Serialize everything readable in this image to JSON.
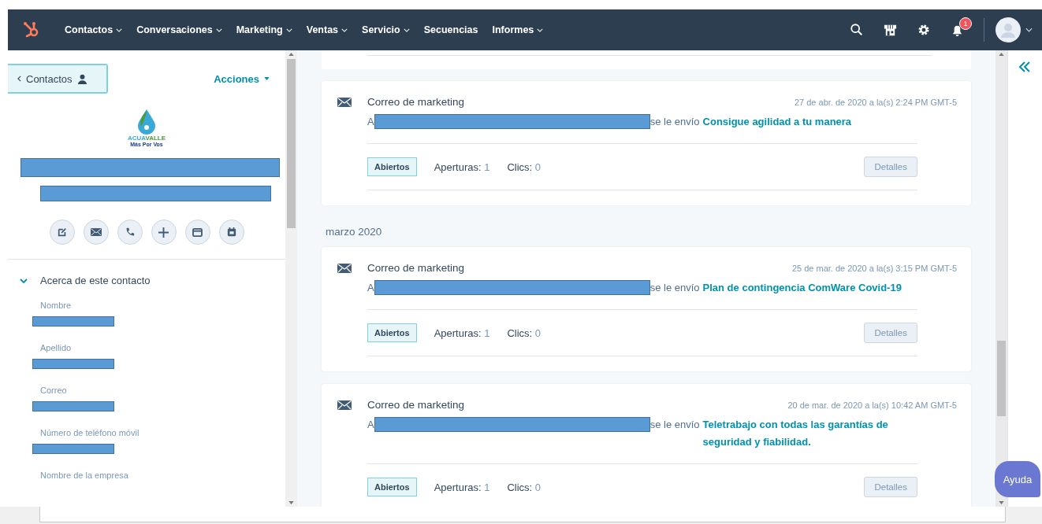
{
  "nav": {
    "items": [
      {
        "label": "Contactos",
        "dropdown": true
      },
      {
        "label": "Conversaciones",
        "dropdown": true
      },
      {
        "label": "Marketing",
        "dropdown": true
      },
      {
        "label": "Ventas",
        "dropdown": true
      },
      {
        "label": "Servicio",
        "dropdown": true
      },
      {
        "label": "Secuencias",
        "dropdown": false
      },
      {
        "label": "Informes",
        "dropdown": true
      }
    ],
    "notifications": "1"
  },
  "sidebar": {
    "back": "Contactos",
    "actions": "Acciones",
    "logo": {
      "name_a": "ACUA",
      "name_b": "VALLE",
      "tagline": "Más Por Vos"
    },
    "name_redacted": true,
    "subtitle_redacted": true,
    "section": {
      "title": "Acerca de este contacto",
      "expanded": true,
      "fields": [
        {
          "label": "Nombre",
          "redacted": true
        },
        {
          "label": "Apellido",
          "redacted": true
        },
        {
          "label": "Correo",
          "redacted": true
        },
        {
          "label": "Número de teléfono móvil",
          "redacted": true
        },
        {
          "label": "Nombre de la empresa",
          "redacted": false
        }
      ]
    }
  },
  "timeline": [
    {
      "kind": "card",
      "title": "Correo de marketing",
      "date": "27 de abr. de 2020 a la(s) 2:24 PM GMT-5",
      "prefix": "A",
      "recipient_redacted": true,
      "sent": "se le envío",
      "link": "Consigue agilidad a tu manera",
      "status": "Abiertos",
      "opens_label": "Aperturas:",
      "opens": "1",
      "clicks_label": "Clics:",
      "clicks": "0",
      "details": "Detalles"
    },
    {
      "kind": "month",
      "label": "marzo 2020"
    },
    {
      "kind": "card",
      "title": "Correo de marketing",
      "date": "25 de mar. de 2020 a la(s) 3:15 PM GMT-5",
      "prefix": "A",
      "recipient_redacted": true,
      "sent": "se le envío",
      "link": "Plan de contingencia ComWare Covid-19",
      "status": "Abiertos",
      "opens_label": "Aperturas:",
      "opens": "1",
      "clicks_label": "Clics:",
      "clicks": "0",
      "details": "Detalles"
    },
    {
      "kind": "card",
      "title": "Correo de marketing",
      "date": "20 de mar. de 2020 a la(s) 10:42 AM GMT-5",
      "prefix": "A",
      "recipient_redacted": true,
      "sent": "se le envío",
      "link": "Teletrabajo con todas las garantías de seguridad y fiabilidad.",
      "status": "Abiertos",
      "opens_label": "Aperturas:",
      "opens": "1",
      "clicks_label": "Clics:",
      "clicks": "0",
      "details": "Detalles"
    }
  ],
  "help": "Ayuda"
}
